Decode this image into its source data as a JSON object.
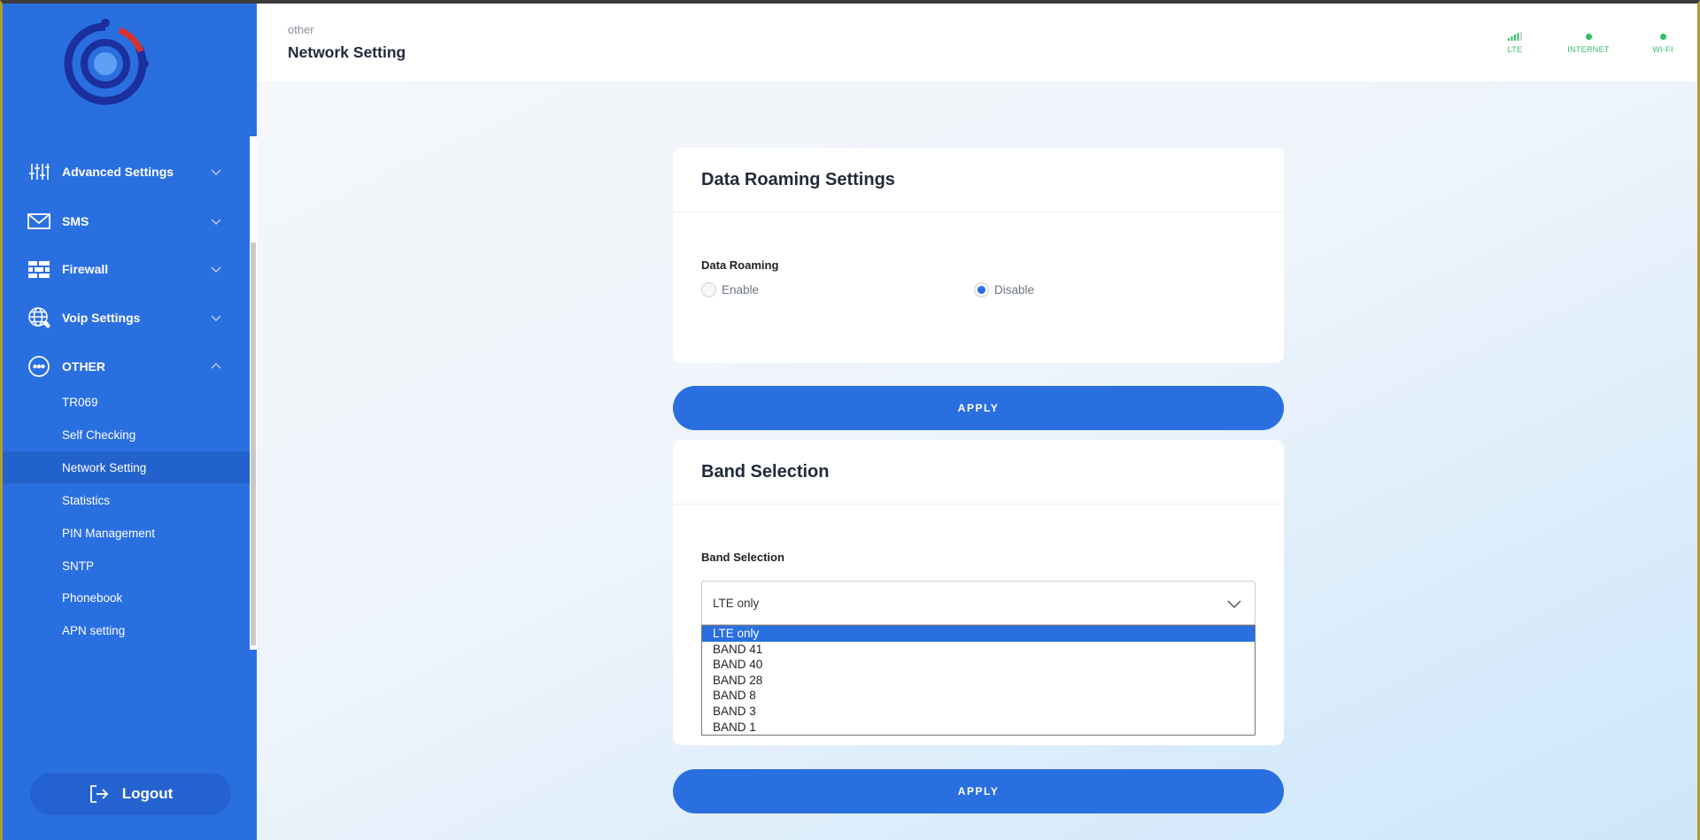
{
  "sidebar": {
    "menu": [
      {
        "label": "Advanced Settings",
        "icon": "sliders-icon",
        "expanded": false
      },
      {
        "label": "SMS",
        "icon": "envelope-icon",
        "expanded": false
      },
      {
        "label": "Firewall",
        "icon": "firewall-icon",
        "expanded": false
      },
      {
        "label": "Voip Settings",
        "icon": "globe-icon",
        "expanded": false
      },
      {
        "label": "OTHER",
        "icon": "more-circle-icon",
        "expanded": true
      }
    ],
    "submenu": [
      {
        "label": "TR069"
      },
      {
        "label": "Self Checking"
      },
      {
        "label": "Network Setting",
        "active": true
      },
      {
        "label": "Statistics"
      },
      {
        "label": "PIN Management"
      },
      {
        "label": "SNTP"
      },
      {
        "label": "Phonebook"
      },
      {
        "label": "APN setting"
      }
    ],
    "logout_label": "Logout"
  },
  "header": {
    "breadcrumb_parent": "other",
    "page_title": "Network Setting",
    "status": [
      {
        "label": "LTE",
        "icon": "signal-bars-icon"
      },
      {
        "label": "INTERNET",
        "icon": "status-dot-icon"
      },
      {
        "label": "WI-FI",
        "icon": "status-dot-icon"
      }
    ]
  },
  "roaming_card": {
    "title": "Data Roaming Settings",
    "field_label": "Data Roaming",
    "options": [
      {
        "label": "Enable",
        "checked": false
      },
      {
        "label": "Disable",
        "checked": true
      }
    ],
    "apply_label": "APPLY"
  },
  "band_card": {
    "title": "Band Selection",
    "field_label": "Band Selection",
    "selected_value": "LTE only",
    "options": [
      "LTE only",
      "BAND 41",
      "BAND 40",
      "BAND 28",
      "BAND 8",
      "BAND 3",
      "BAND 1"
    ],
    "apply_label": "APPLY"
  },
  "colors": {
    "sidebar_bg": "#2a6fe0",
    "accent": "#2a6fe0",
    "status_green": "#2fbf63"
  }
}
